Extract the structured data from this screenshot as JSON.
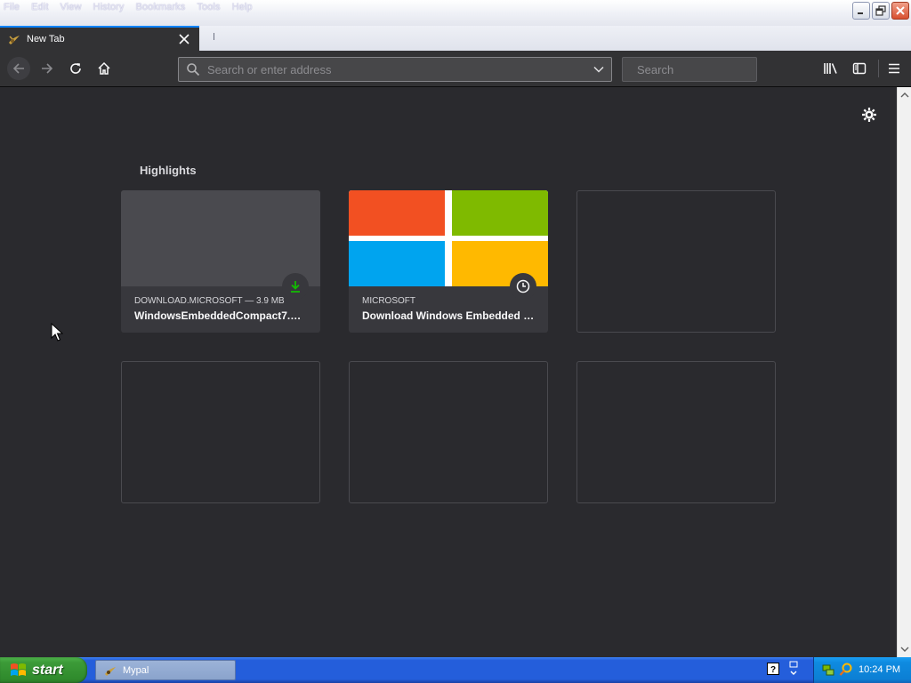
{
  "menubar": {
    "items": [
      "File",
      "Edit",
      "View",
      "History",
      "Bookmarks",
      "Tools",
      "Help"
    ]
  },
  "window_controls": [
    "minimize-icon",
    "restore-icon",
    "close-icon"
  ],
  "tab": {
    "title": "New Tab",
    "icon": "mypal-favicon"
  },
  "navbar": {
    "url_placeholder": "Search or enter address",
    "search_placeholder": "Search"
  },
  "content": {
    "section_title": "Highlights",
    "highlights": [
      {
        "source": "DOWNLOAD.MICROSOFT — 3.9 MB",
        "title": "WindowsEmbeddedCompact7.…",
        "badge_icon": "download-icon",
        "badge_color": "#12bc00"
      },
      {
        "source": "MICROSOFT",
        "title": "Download Windows Embedded …",
        "badge_icon": "clock-icon",
        "thumbnail": "microsoft-logo"
      }
    ]
  },
  "taskbar": {
    "start_label": "start",
    "task_label": "Mypal",
    "clock": "10:24 PM"
  },
  "colors": {
    "accent": "#0a84ff",
    "background": "#2a2a2e",
    "toolbar": "#323234",
    "ms_red": "#f25022",
    "ms_green": "#7fba00",
    "ms_blue": "#00a4ef",
    "ms_yellow": "#ffb900"
  }
}
